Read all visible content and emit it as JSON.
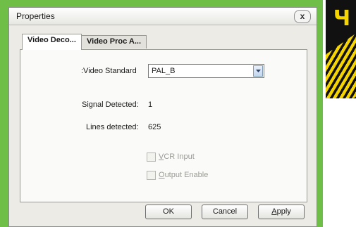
{
  "window": {
    "title": "Properties",
    "close_label": "x"
  },
  "tabs": [
    {
      "label": "Video Deco...",
      "active": true
    },
    {
      "label": "Video Proc A...",
      "active": false
    }
  ],
  "video_decoder": {
    "video_standard_label": ":Video Standard",
    "video_standard_value": "PAL_B",
    "signal_detected_label": "Signal Detected:",
    "signal_detected_value": "1",
    "lines_detected_label": "Lines detected:",
    "lines_detected_value": "625",
    "vcr_input": {
      "label_accel": "V",
      "label_rest": "CR Input",
      "checked": false,
      "enabled": false
    },
    "output_enable": {
      "label_accel": "O",
      "label_rest": "utput Enable",
      "checked": false,
      "enabled": false
    }
  },
  "buttons": {
    "ok": "OK",
    "cancel": "Cancel",
    "apply_accel": "A",
    "apply_rest": "pply"
  },
  "decoration": {
    "badge_glyph": "Ч",
    "badge_color": "#f5d400",
    "background_color": "#6fbe47"
  }
}
